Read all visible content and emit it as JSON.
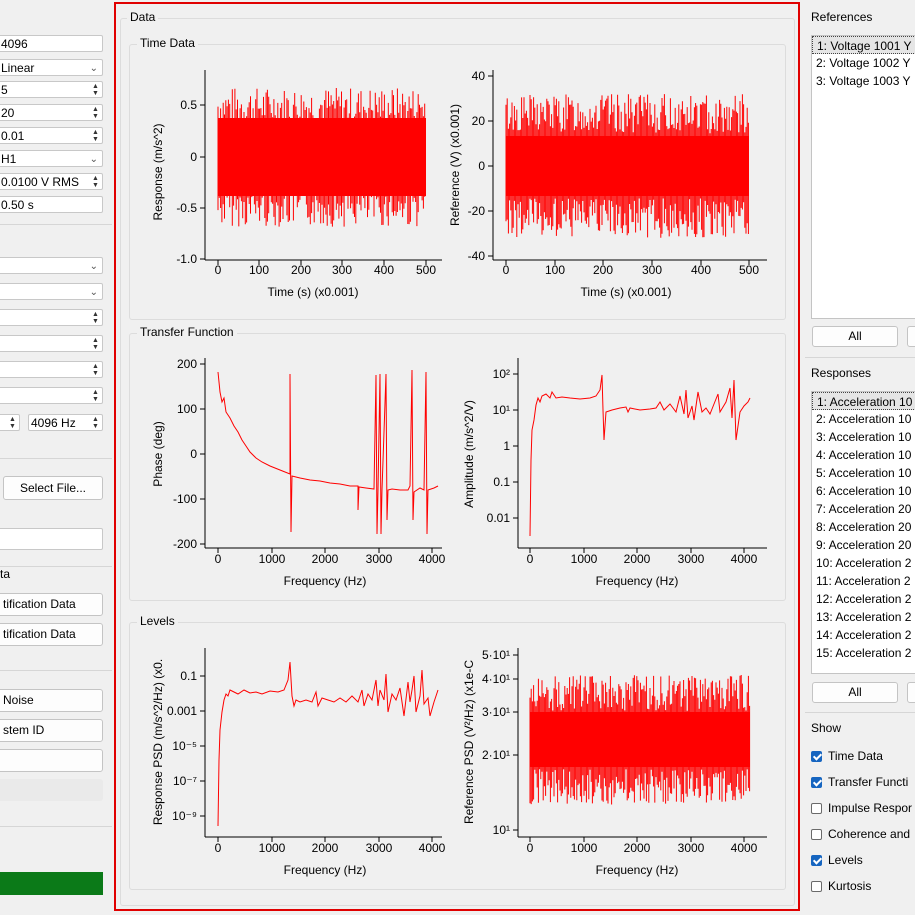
{
  "left_panel": {
    "fields": [
      {
        "text": "4096",
        "kind": "text"
      },
      {
        "text": "Linear",
        "kind": "combo"
      },
      {
        "text": "5",
        "kind": "spin"
      },
      {
        "text": "20",
        "kind": "spin"
      },
      {
        "text": "0.01",
        "kind": "spin"
      },
      {
        "text": "H1",
        "kind": "combo"
      },
      {
        "text": "0.0100 V RMS",
        "kind": "spin"
      },
      {
        "text": "0.50 s",
        "kind": "text"
      }
    ],
    "hz_field": "4096 Hz",
    "select_file_label": "Select File...",
    "section_fragment": "ta",
    "btn_load_ident": "tification Data",
    "btn_save_ident": "tification Data",
    "btn_noise": "Noise",
    "btn_system_id": "stem ID"
  },
  "data_group": {
    "title": "Data",
    "time_title": "Time Data",
    "tf_title": "Transfer Function",
    "levels_title": "Levels"
  },
  "plots": {
    "response_time": {
      "ylabel": "Response (m/s^2)",
      "xlabel": "Time (s) (x0.001)",
      "yticks": [
        "0.5",
        "0",
        "-0.5",
        "-1.0"
      ],
      "xticks": [
        "0",
        "100",
        "200",
        "300",
        "400",
        "500"
      ]
    },
    "reference_time": {
      "ylabel": "Reference (V) (x0.001)",
      "xlabel": "Time (s) (x0.001)",
      "yticks": [
        "40",
        "20",
        "0",
        "-20",
        "-40"
      ],
      "xticks": [
        "0",
        "100",
        "200",
        "300",
        "400",
        "500"
      ]
    },
    "phase": {
      "ylabel": "Phase (deg)",
      "xlabel": "Frequency (Hz)",
      "yticks": [
        "200",
        "100",
        "0",
        "-100",
        "-200"
      ],
      "xticks": [
        "0",
        "1000",
        "2000",
        "3000",
        "4000"
      ]
    },
    "amplitude": {
      "ylabel": "Amplitude (m/s^2/V)",
      "xlabel": "Frequency (Hz)",
      "yticks": [
        "10²",
        "10¹",
        "1",
        "0.1",
        "0.01"
      ],
      "xticks": [
        "0",
        "1000",
        "2000",
        "3000",
        "4000"
      ]
    },
    "response_psd": {
      "ylabel": "Response PSD (m/s^2/Hz) (x0.",
      "xlabel": "Frequency (Hz)",
      "yticks": [
        "0.1",
        "0.001",
        "10⁻⁵",
        "10⁻⁷",
        "10⁻⁹"
      ],
      "xticks": [
        "0",
        "1000",
        "2000",
        "3000",
        "4000"
      ]
    },
    "reference_psd": {
      "ylabel": "Reference PSD (V²/Hz) (x1e-C",
      "xlabel": "Frequency (Hz)",
      "yticks": [
        "5·10¹",
        "4·10¹",
        "3·10¹",
        "2·10¹",
        "10¹"
      ],
      "xticks": [
        "0",
        "1000",
        "2000",
        "3000",
        "4000"
      ]
    }
  },
  "references": {
    "title": "References",
    "items": [
      "1: Voltage 1001 Y",
      "2: Voltage 1002 Y",
      "3: Voltage 1003 Y"
    ],
    "all_label": "All"
  },
  "responses": {
    "title": "Responses",
    "items": [
      "1: Acceleration 10",
      "2: Acceleration 10",
      "3: Acceleration 10",
      "4: Acceleration 10",
      "5: Acceleration 10",
      "6: Acceleration 10",
      "7: Acceleration 20",
      "8: Acceleration 20",
      "9: Acceleration 20",
      "10: Acceleration 2",
      "11: Acceleration 2",
      "12: Acceleration 2",
      "13: Acceleration 2",
      "14: Acceleration 2",
      "15: Acceleration 2"
    ],
    "all_label": "All"
  },
  "show": {
    "title": "Show",
    "options": [
      {
        "label": "Time Data",
        "checked": true
      },
      {
        "label": "Transfer Functi",
        "checked": true
      },
      {
        "label": "Impulse Respor",
        "checked": false
      },
      {
        "label": "Coherence and",
        "checked": false
      },
      {
        "label": "Levels",
        "checked": true
      },
      {
        "label": "Kurtosis",
        "checked": false
      }
    ]
  },
  "colors": {
    "trace": "#ff0000",
    "highlight_border": "#e00000",
    "progress": "#0b7a18"
  }
}
